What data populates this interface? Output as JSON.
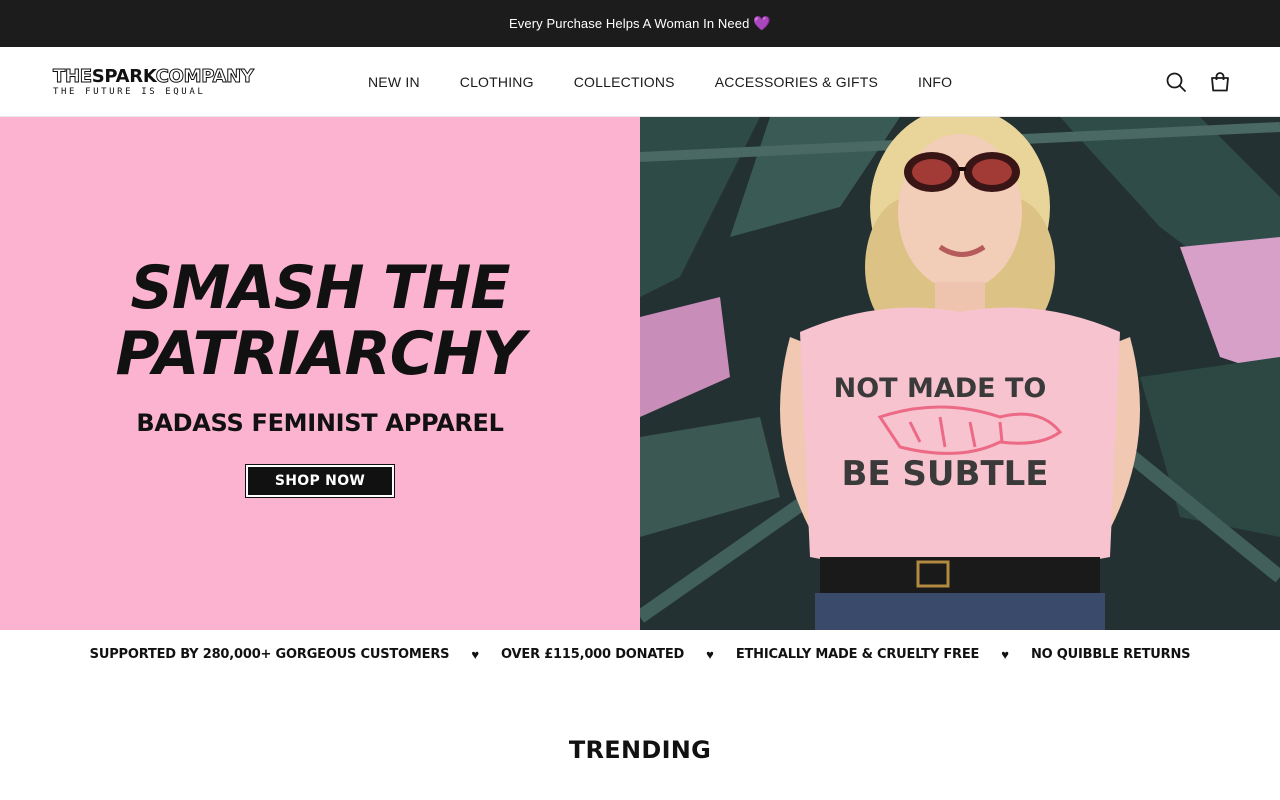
{
  "announcement": {
    "text": "Every Purchase Helps A Woman In Need",
    "emoji": "💜"
  },
  "header": {
    "logo": {
      "word1": "THE",
      "word2": "SPARK",
      "word3": "COMPANY",
      "tagline": "THE  FUTURE  IS  EQUAL"
    },
    "nav": [
      "NEW IN",
      "CLOTHING",
      "COLLECTIONS",
      "ACCESSORIES & GIFTS",
      "INFO"
    ],
    "icons": [
      "search-icon",
      "cart-icon"
    ]
  },
  "hero": {
    "headline_line1": "SMASH THE",
    "headline_line2": "PATRIARCHY",
    "subheading": "BADASS FEMINIST APPAREL",
    "button_label": "SHOP NOW",
    "shirt_text_top": "NOT MADE TO",
    "shirt_text_bottom": "BE SUBTLE",
    "colors": {
      "panel_bg": "#fbb3cf",
      "shirt": "#f7c3cf"
    }
  },
  "trust_strip": [
    "SUPPORTED BY 280,000+ GORGEOUS CUSTOMERS",
    "OVER £115,000 DONATED",
    "ETHICALLY MADE & CRUELTY FREE",
    "NO QUIBBLE RETURNS"
  ],
  "trust_separator": "♥",
  "section": {
    "title": "TRENDING"
  }
}
